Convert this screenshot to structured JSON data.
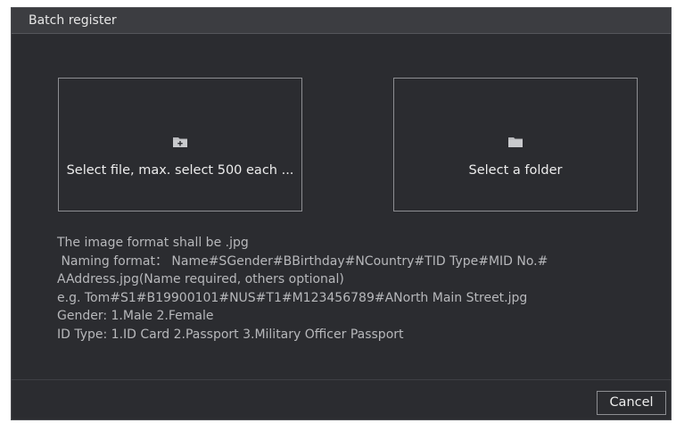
{
  "dialog": {
    "title": "Batch register"
  },
  "select_file": {
    "label": "Select file, max. select 500 each ...",
    "icon": "add-folder-icon"
  },
  "select_folder": {
    "label": "Select a folder",
    "icon": "folder-icon"
  },
  "info": {
    "lines": [
      "The image format shall be  .jpg",
      " Naming format： Name#SGender#BBirthday#NCountry#TID Type#MID No.#",
      "AAddress.jpg(Name required, others optional)",
      "e.g. Tom#S1#B19900101#NUS#T1#M123456789#ANorth Main Street.jpg",
      "Gender: 1.Male 2.Female",
      "ID Type: 1.ID Card 2.Passport 3.Military Officer Passport"
    ]
  },
  "footer": {
    "cancel_label": "Cancel"
  },
  "colors": {
    "background": "#2b2c30",
    "titlebar": "#3c3d41",
    "border": "#8d8e92",
    "text": "#ececec",
    "info_text": "#b7b8bb"
  }
}
